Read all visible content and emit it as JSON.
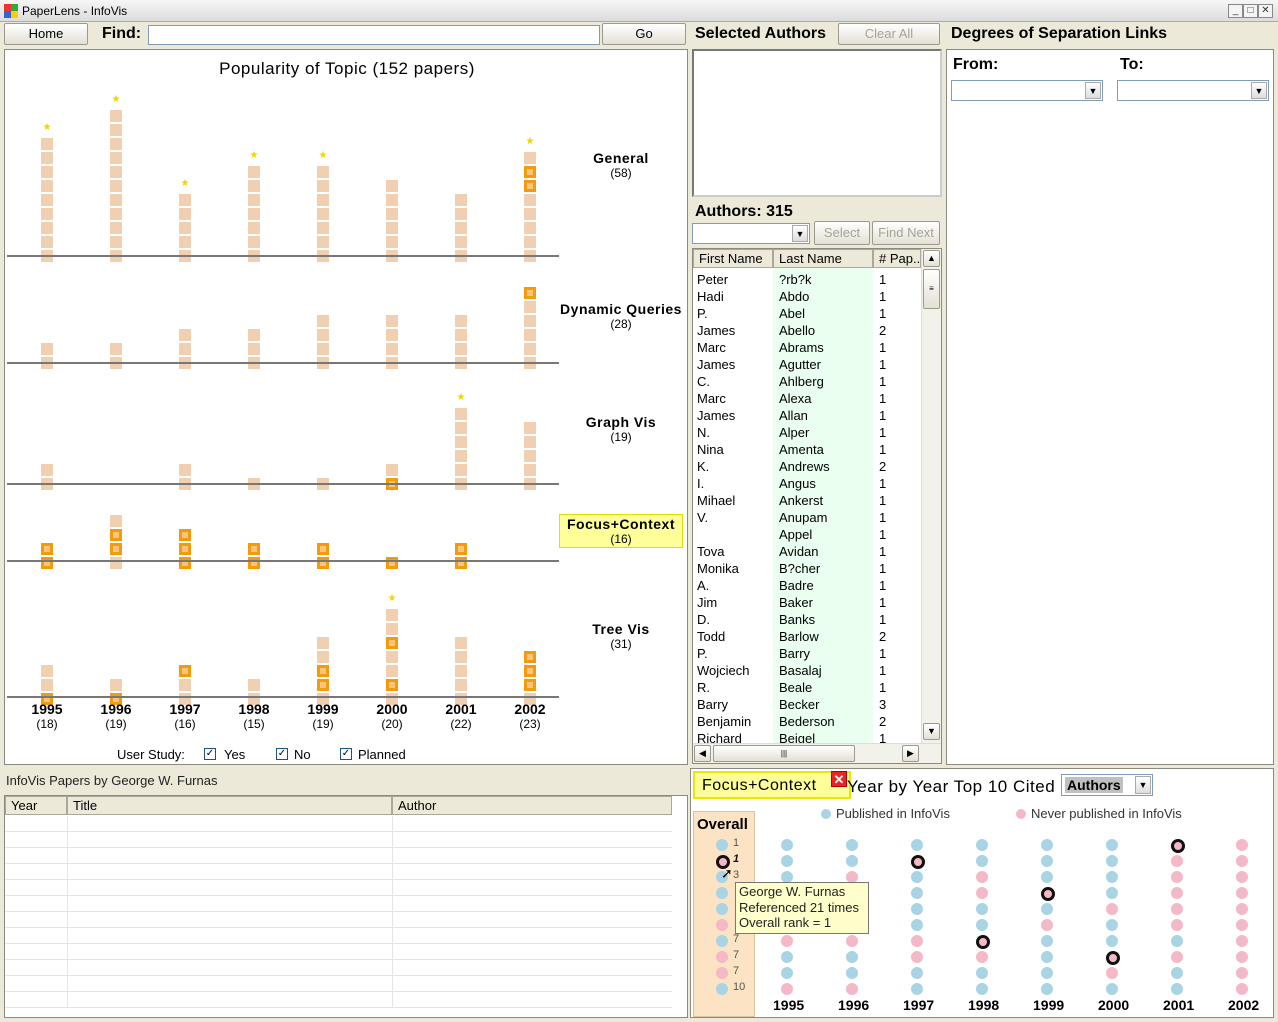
{
  "window": {
    "title": "PaperLens - InfoVis"
  },
  "toolbar": {
    "home": "Home",
    "find_label": "Find:",
    "find_value": "",
    "go": "Go"
  },
  "selected_authors": {
    "title": "Selected Authors",
    "clear_all": "Clear All"
  },
  "degrees": {
    "title": "Degrees of Separation Links",
    "from_label": "From:",
    "to_label": "To:"
  },
  "popularity": {
    "title": "Popularity of Topic (152 papers)",
    "years": [
      {
        "year": "1995",
        "count": "(18)"
      },
      {
        "year": "1996",
        "count": "(19)"
      },
      {
        "year": "1997",
        "count": "(16)"
      },
      {
        "year": "1998",
        "count": "(15)"
      },
      {
        "year": "1999",
        "count": "(19)"
      },
      {
        "year": "2000",
        "count": "(20)"
      },
      {
        "year": "2001",
        "count": "(22)"
      },
      {
        "year": "2002",
        "count": "(23)"
      }
    ],
    "topics": [
      {
        "name": "General",
        "count": "(58)"
      },
      {
        "name": "Dynamic Queries",
        "count": "(28)"
      },
      {
        "name": "Graph Vis",
        "count": "(19)"
      },
      {
        "name": "Focus+Context",
        "count": "(16)"
      },
      {
        "name": "Tree Vis",
        "count": "(31)"
      }
    ],
    "user_study_label": "User Study:",
    "yes": "Yes",
    "no": "No",
    "planned": "Planned"
  },
  "authors": {
    "title": "Authors: 315",
    "select": "Select",
    "find_next": "Find Next",
    "columns": [
      "First Name",
      "Last Name",
      "# Pap..."
    ],
    "rows": [
      [
        "Peter",
        "?rb?k",
        "1"
      ],
      [
        "Hadi",
        "Abdo",
        "1"
      ],
      [
        "P.",
        "Abel",
        "1"
      ],
      [
        "James",
        "Abello",
        "2"
      ],
      [
        "Marc",
        "Abrams",
        "1"
      ],
      [
        "James",
        "Agutter",
        "1"
      ],
      [
        "C.",
        "Ahlberg",
        "1"
      ],
      [
        "Marc",
        "Alexa",
        "1"
      ],
      [
        "James",
        "Allan",
        "1"
      ],
      [
        "N.",
        "Alper",
        "1"
      ],
      [
        "Nina",
        "Amenta",
        "1"
      ],
      [
        "K.",
        "Andrews",
        "2"
      ],
      [
        "I.",
        "Angus",
        "1"
      ],
      [
        "Mihael",
        "Ankerst",
        "1"
      ],
      [
        "V.",
        "Anupam",
        "1"
      ],
      [
        "",
        "Appel",
        "1"
      ],
      [
        "Tova",
        "Avidan",
        "1"
      ],
      [
        "Monika",
        "B?cher",
        "1"
      ],
      [
        "A.",
        "Badre",
        "1"
      ],
      [
        "Jim",
        "Baker",
        "1"
      ],
      [
        "D.",
        "Banks",
        "1"
      ],
      [
        "Todd",
        "Barlow",
        "2"
      ],
      [
        "P.",
        "Barry",
        "1"
      ],
      [
        "Wojciech",
        "Basalaj",
        "1"
      ],
      [
        "R.",
        "Beale",
        "1"
      ],
      [
        "Barry",
        "Becker",
        "3"
      ],
      [
        "Benjamin",
        "Bederson",
        "2"
      ],
      [
        "Richard",
        "Beigel",
        "1"
      ]
    ]
  },
  "papers": {
    "title": "InfoVis Papers by George W. Furnas",
    "columns": [
      "Year",
      "Title",
      "Author"
    ]
  },
  "cited": {
    "topic_tag": "Focus+Context",
    "title": "Year by Year Top 10 Cited",
    "mode": "Authors",
    "legend_pub": "Published in InfoVis",
    "legend_never": "Never published in InfoVis",
    "overall": "Overall",
    "tooltip": [
      "George W. Furnas",
      "Referenced 21 times",
      "Overall rank = 1"
    ],
    "overall_ranks": [
      "1",
      "1",
      "3",
      "",
      "",
      "",
      "7",
      "7",
      "7",
      "10"
    ],
    "years": [
      "1995",
      "1996",
      "1997",
      "1998",
      "1999",
      "2000",
      "2001",
      "2002"
    ]
  },
  "colors": {
    "cell": "#f1cfb1",
    "highlight": "#f39b0d",
    "star": "#f1d500",
    "published": "#a8d4e6",
    "never": "#f5b8c6",
    "tag_bg": "#ffff99"
  }
}
